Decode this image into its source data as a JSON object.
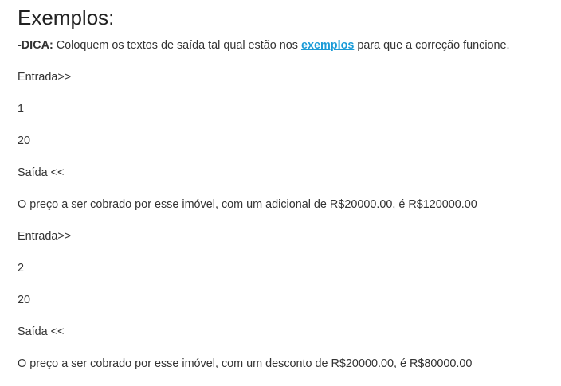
{
  "heading": "Exemplos:",
  "tip": {
    "label": "-DICA:",
    "before_link": " Coloquem os textos de saída tal qual estão nos ",
    "link": "exemplos",
    "after_link": " para que a correção funcione."
  },
  "examples": [
    {
      "input_label": "Entrada>>",
      "input_values": [
        "1",
        "20"
      ],
      "output_label": "Saída <<",
      "output_text": "O preço a ser cobrado por esse imóvel, com um adicional de R$20000.00, é R$120000.00"
    },
    {
      "input_label": "Entrada>>",
      "input_values": [
        "2",
        "20"
      ],
      "output_label": "Saída <<",
      "output_text": "O preço a ser cobrado por esse imóvel, com um desconto de R$20000.00, é R$80000.00"
    }
  ]
}
